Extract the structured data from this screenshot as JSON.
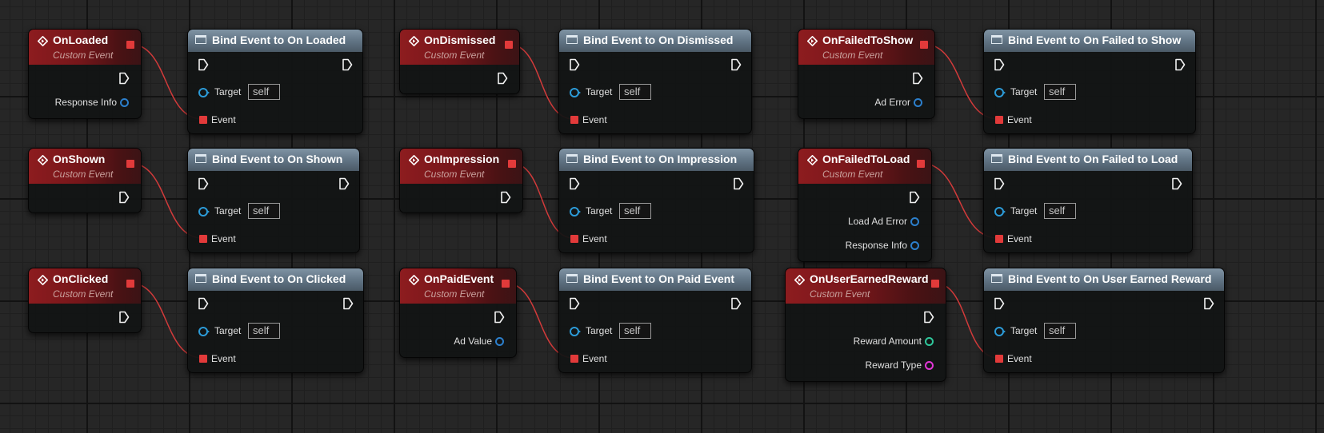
{
  "event_subtitle": "Custom Event",
  "bind": {
    "target_label": "Target",
    "target_value": "self",
    "event_label": "Event"
  },
  "events": [
    {
      "title": "OnLoaded",
      "outputs": [
        {
          "label": "Response Info",
          "type": "struct"
        }
      ]
    },
    {
      "title": "OnShown",
      "outputs": []
    },
    {
      "title": "OnClicked",
      "outputs": []
    },
    {
      "title": "OnDismissed",
      "outputs": []
    },
    {
      "title": "OnImpression",
      "outputs": []
    },
    {
      "title": "OnPaidEvent",
      "outputs": [
        {
          "label": "Ad Value",
          "type": "struct"
        }
      ]
    },
    {
      "title": "OnFailedToShow",
      "outputs": [
        {
          "label": "Ad Error",
          "type": "struct"
        }
      ]
    },
    {
      "title": "OnFailedToLoad",
      "outputs": [
        {
          "label": "Load Ad Error",
          "type": "struct"
        },
        {
          "label": "Response Info",
          "type": "struct"
        }
      ]
    },
    {
      "title": "OnUserEarnedReward",
      "outputs": [
        {
          "label": "Reward Amount",
          "type": "int"
        },
        {
          "label": "Reward Type",
          "type": "string"
        }
      ]
    }
  ],
  "binds": [
    {
      "title": "Bind Event to On Loaded"
    },
    {
      "title": "Bind Event to On Shown"
    },
    {
      "title": "Bind Event to On Clicked"
    },
    {
      "title": "Bind Event to On Dismissed"
    },
    {
      "title": "Bind Event to On Impression"
    },
    {
      "title": "Bind Event to On Paid Event"
    },
    {
      "title": "Bind Event to On Failed to Show"
    },
    {
      "title": "Bind Event to On Failed to Load"
    },
    {
      "title": "Bind Event to On User Earned Reward"
    }
  ],
  "colors": {
    "event_header": "#8d1c1f",
    "function_header": "#6c7f8f",
    "delegate_wire": "#d23a3a",
    "struct_pin": "#2c7fcc",
    "int_pin": "#2fc79b",
    "string_pin": "#e236d7",
    "grid_bg": "#262626"
  }
}
